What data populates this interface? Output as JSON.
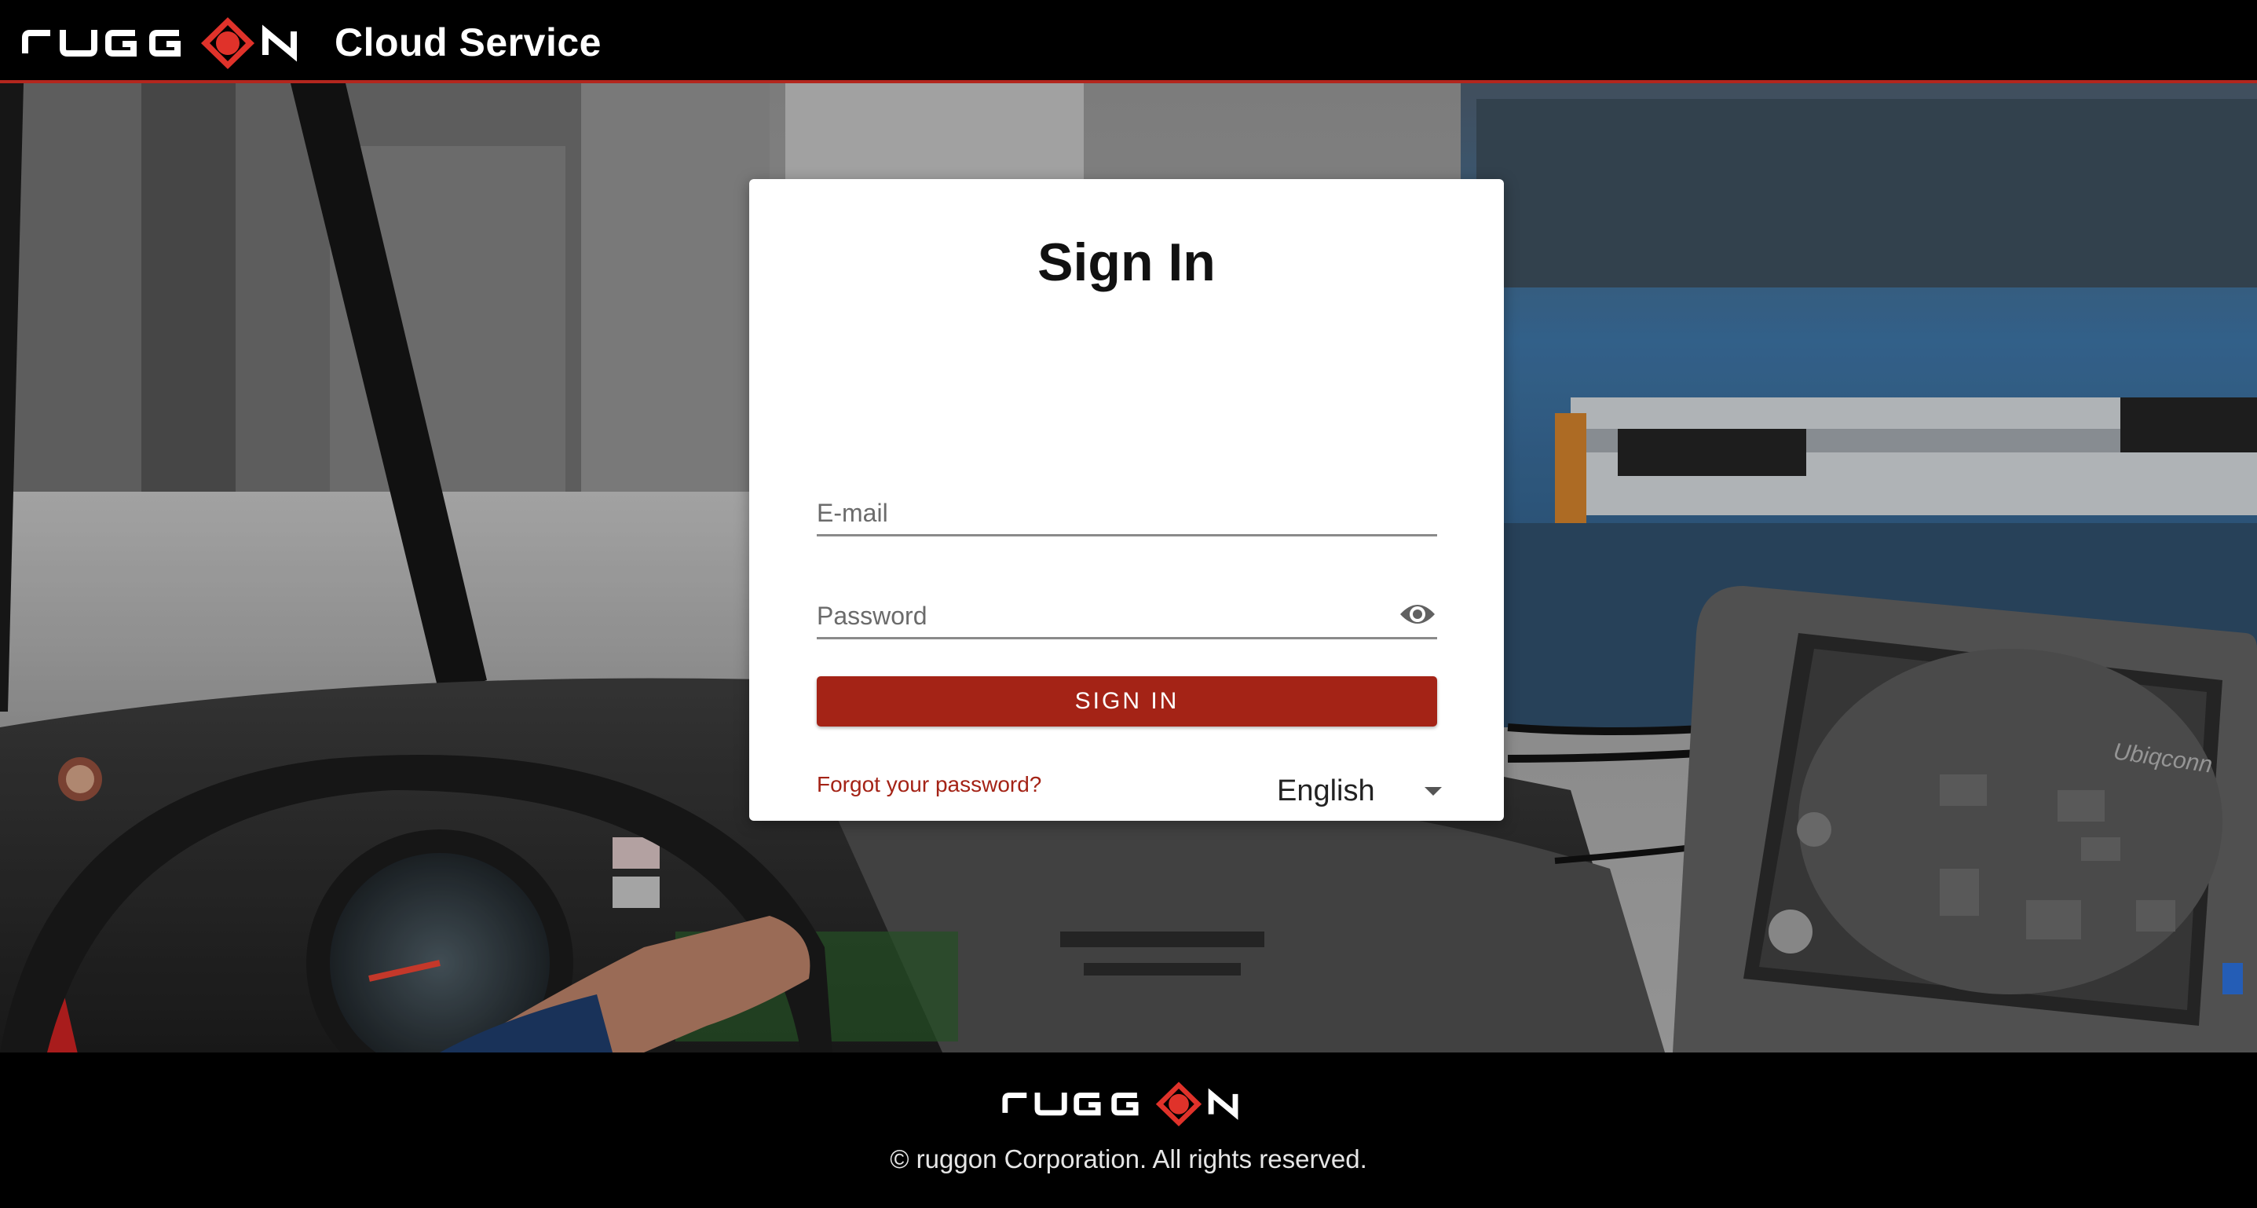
{
  "header": {
    "logo_text": "ruggon",
    "title": "Cloud Service"
  },
  "login": {
    "title": "Sign In",
    "email": {
      "placeholder": "E-mail",
      "value": ""
    },
    "password": {
      "placeholder": "Password",
      "value": ""
    },
    "signin_label": "SIGN IN",
    "forgot_label": "Forgot your password?",
    "language": "English"
  },
  "footer": {
    "logo_text": "ruggon",
    "copyright": "© ruggon Corporation. All rights reserved."
  },
  "background": {
    "device_brand": "Ubiqconn"
  },
  "colors": {
    "accent": "#a42316",
    "header_border": "#b3261e",
    "logo_red": "#e0322a"
  },
  "icons": {
    "password_visibility": "eye-icon",
    "language_dropdown": "caret-down-icon"
  }
}
